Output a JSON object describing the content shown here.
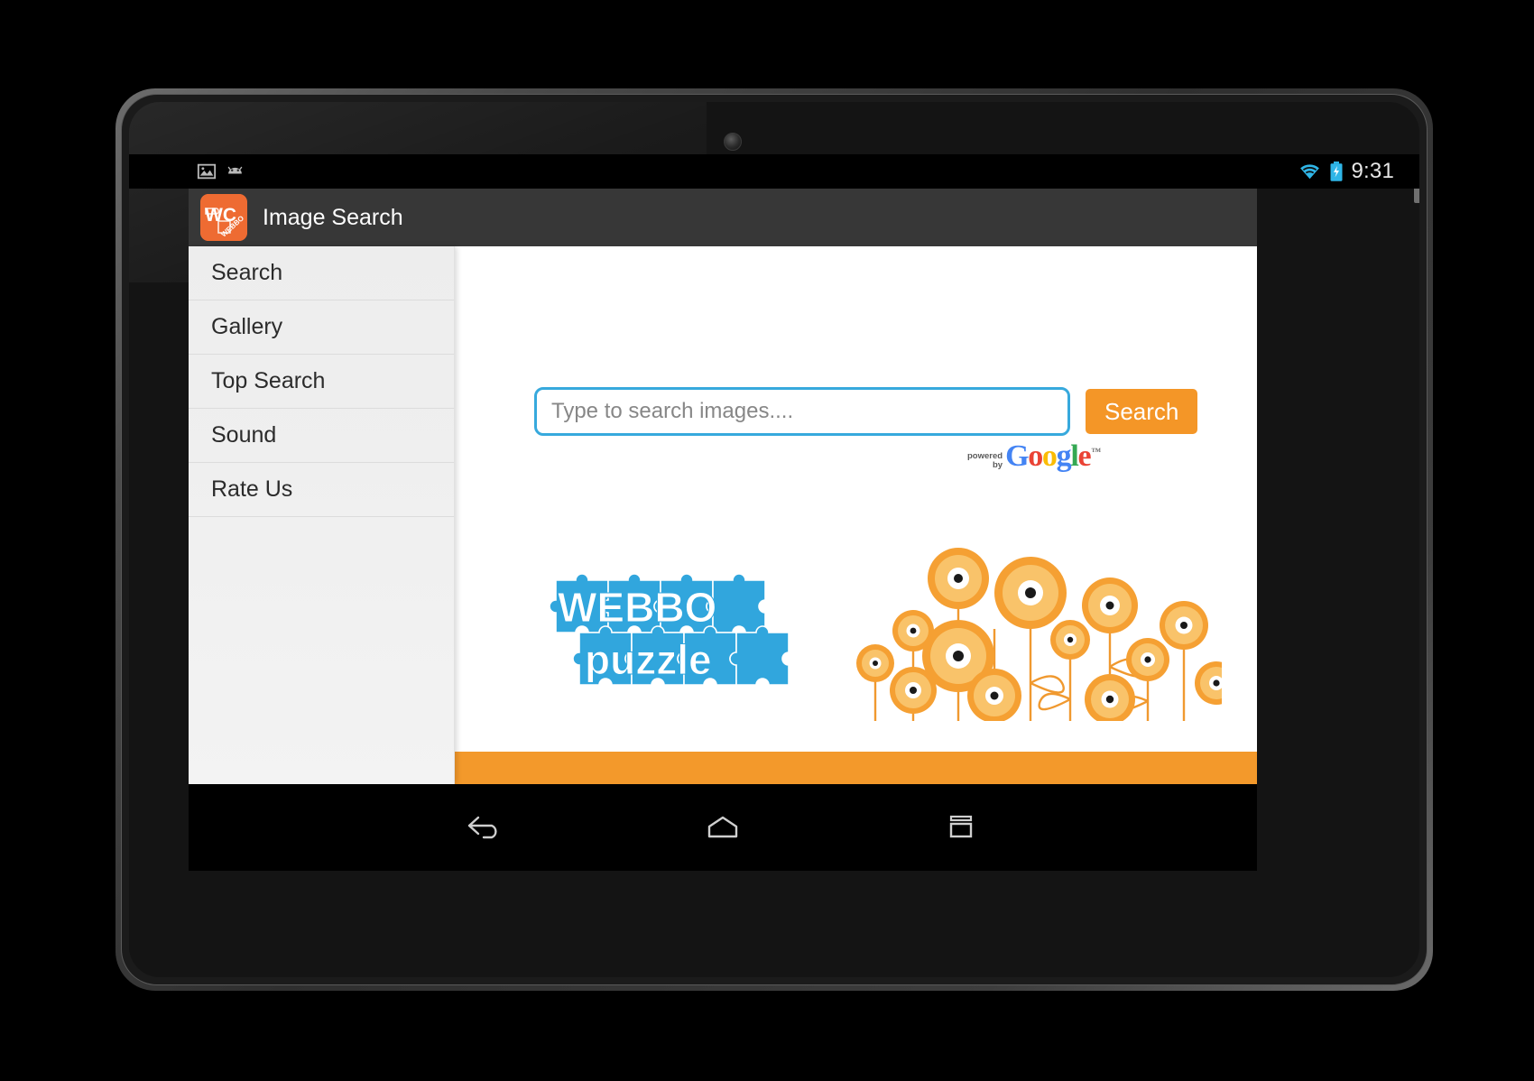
{
  "device": {
    "type": "android-tablet",
    "camera_label": "front-camera"
  },
  "status_bar": {
    "left_icons": [
      "image-notification-icon",
      "android-notification-icon"
    ],
    "right_icons": [
      "wifi-icon",
      "battery-charging-icon"
    ],
    "clock": "9:31"
  },
  "action_bar": {
    "app_icon": "webbo-puzzle-app-icon",
    "title": "Image Search",
    "background": "#373737"
  },
  "sidebar": {
    "items": [
      {
        "label": "Search"
      },
      {
        "label": "Gallery"
      },
      {
        "label": "Top Search"
      },
      {
        "label": "Sound"
      },
      {
        "label": "Rate Us"
      }
    ]
  },
  "main": {
    "search": {
      "value": "",
      "placeholder": "Type to search images....",
      "button_label": "Search",
      "input_border_color": "#37a9dd",
      "button_color": "#f49627"
    },
    "google_badge": {
      "powered": "powered",
      "by": "by",
      "letters": [
        "G",
        "o",
        "o",
        "g",
        "l",
        "e"
      ],
      "trademark": "™"
    },
    "artwork": {
      "puzzle_wordmark": "WEBBO PUZZLE",
      "puzzle_color": "#31a6dd",
      "flowers_label": "orange-flowers-illustration",
      "flower_color": "#f59b2c",
      "flower_inner_color": "#f9c36a"
    },
    "bottom_banner_color": "#f3992b"
  },
  "nav_bar": {
    "buttons": [
      {
        "name": "back-button",
        "label": "Back"
      },
      {
        "name": "home-button",
        "label": "Home"
      },
      {
        "name": "recents-button",
        "label": "Recent apps"
      }
    ]
  }
}
